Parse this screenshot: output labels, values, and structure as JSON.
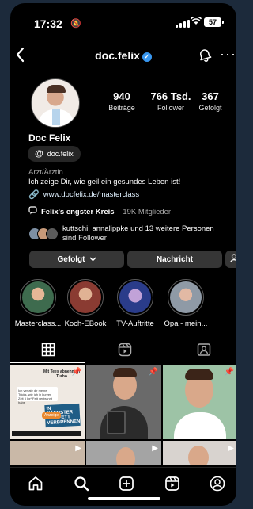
{
  "status": {
    "time": "17:32",
    "battery": "57"
  },
  "header": {
    "username": "doc.felix"
  },
  "stats": [
    {
      "number": "940",
      "label": "Beiträge"
    },
    {
      "number": "766 Tsd.",
      "label": "Follower"
    },
    {
      "number": "367",
      "label": "Gefolgt"
    }
  ],
  "profile": {
    "name": "Doc Felix",
    "threads_handle": "doc.felix",
    "category": "Arzt/Ärztin",
    "bio": "Ich zeige Dir, wie geil ein gesundes Leben ist!",
    "link": "www.docfelix.de/masterclass",
    "circle_name": "Felix's engster Kreis",
    "circle_members": "· 19K Mitglieder",
    "followed_by_line1": "kuttschi, annalippke und 13 weitere Personen",
    "followed_by_line2": "sind Follower"
  },
  "buttons": {
    "following": "Gefolgt",
    "message": "Nachricht"
  },
  "highlights": [
    {
      "label": "Masterclass...",
      "color": "#5a9a6a"
    },
    {
      "label": "Koch-EBook",
      "color": "#c44b3b"
    },
    {
      "label": "TV-Auftritte",
      "color": "#3b5bc4"
    },
    {
      "label": "Opa - mein...",
      "color": "#8da4b8"
    }
  ],
  "post1": {
    "title": "Mit Tees abnehmen Turbo",
    "note": "Ich verrate dir meine Tricks, wie ich in kurzer Zeit 5 kg* Fett verbrannt habe",
    "banner": "IN NÄCHSTER ZEIT FETT VERBRENNEN",
    "tag": "Anzeige"
  },
  "colors": {
    "verified": "#3897f0",
    "background": "#000000"
  }
}
